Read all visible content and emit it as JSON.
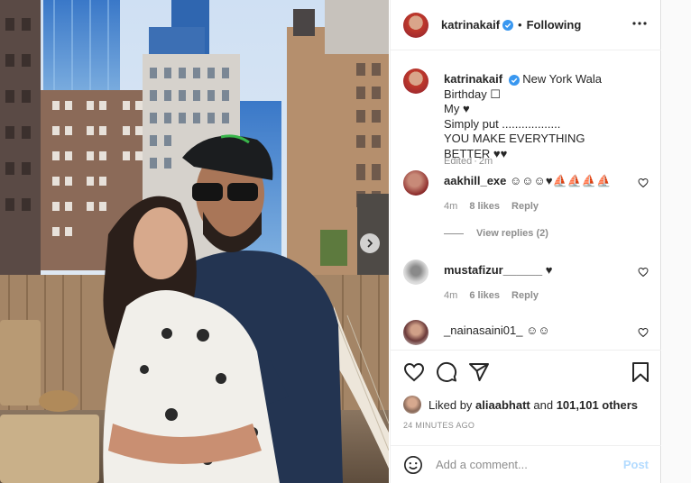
{
  "post": {
    "username": "katrinakaif",
    "follow_status": "Following",
    "dot": "•",
    "photo_alt": "Couple hugging on a New York rooftop"
  },
  "caption": {
    "username": "katrinakaif",
    "line1": "New York Wala Birthday ☐",
    "line2": "My ♥",
    "line3": "Simply put ..................",
    "line4": "YOU MAKE EVERYTHING BETTER ♥♥",
    "edited": "Edited",
    "time": "2m"
  },
  "comments": [
    {
      "username": "aakhill_exe",
      "text": "☺☺☺♥⛵⛵⛵⛵",
      "time": "4m",
      "likes": "8 likes",
      "reply": "Reply",
      "view_replies": "View replies (2)"
    },
    {
      "username": "mustafizur______",
      "text": "♥",
      "time": "4m",
      "likes": "6 likes",
      "reply": "Reply"
    },
    {
      "username": "_nainasaini01_",
      "text": "☺☺"
    }
  ],
  "likes": {
    "prefix": "Liked by",
    "user": "aliaabhatt",
    "middle": "and",
    "others": "101,101 others"
  },
  "timestamp": "24 MINUTES AGO",
  "comment_box": {
    "placeholder": "Add a comment...",
    "post_label": "Post"
  },
  "icons": {
    "verified": "verified-badge-icon",
    "more": "more-options-icon",
    "heart": "heart-icon",
    "comment": "comment-icon",
    "share": "share-icon",
    "save": "bookmark-icon",
    "emoji": "emoji-icon",
    "next": "chevron-right-icon"
  },
  "colors": {
    "verified_blue": "#3897f0",
    "post_button_disabled": "#b3dbff",
    "secondary_text": "#8e8e8e"
  }
}
